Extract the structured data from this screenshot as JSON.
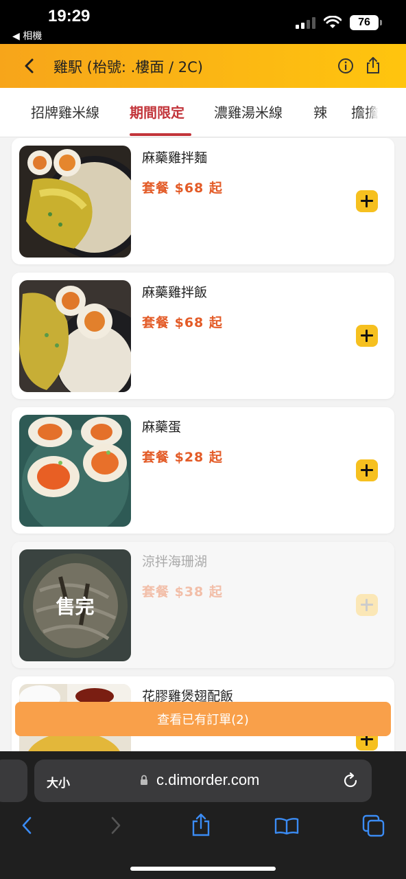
{
  "status_bar": {
    "time": "19:29",
    "back_app": "◀ 相機",
    "battery": "76"
  },
  "header": {
    "title": "雞駅 (枱號: .樓面 / 2C)"
  },
  "tabs": [
    {
      "label": "招牌雞米線"
    },
    {
      "label": "期間限定",
      "active": true
    },
    {
      "label": "濃雞湯米線"
    },
    {
      "label": "辣"
    },
    {
      "label": "擔擔"
    }
  ],
  "menu_items": [
    {
      "name": "麻藥雞拌麵",
      "price": "套餐 $68 起",
      "sold_out": false
    },
    {
      "name": "麻藥雞拌飯",
      "price": "套餐 $68 起",
      "sold_out": false
    },
    {
      "name": "麻藥蛋",
      "price": "套餐 $28 起",
      "sold_out": false
    },
    {
      "name": "涼拌海珊湖",
      "price": "套餐 $38 起",
      "sold_out": true,
      "sold_out_label": "售完"
    },
    {
      "name": "花膠雞煲翅配飯",
      "price": "",
      "sold_out": false
    }
  ],
  "order_bar": {
    "label": "查看已有訂單(2)"
  },
  "browser": {
    "text_size": "大小",
    "url": "c.dimorder.com"
  },
  "colors": {
    "accent": "#ffc50e",
    "price": "#e35b27",
    "active_tab": "#c2343a",
    "order_bar": "#f9a04a"
  }
}
